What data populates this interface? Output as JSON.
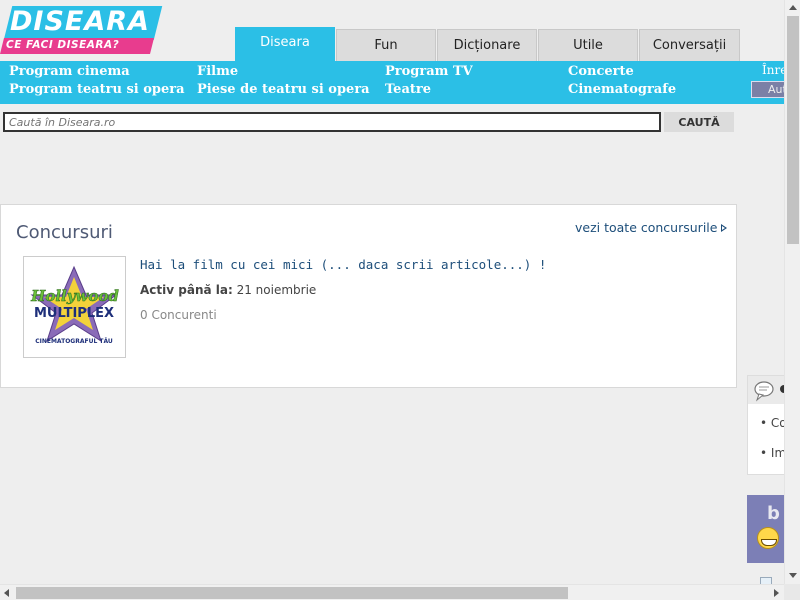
{
  "logo": {
    "title": "DISEARA",
    "tagline": "CE FACI DISEARA?"
  },
  "tabs": [
    {
      "label": "Diseara",
      "active": true
    },
    {
      "label": "Fun",
      "active": false
    },
    {
      "label": "Dicționare",
      "active": false
    },
    {
      "label": "Utile",
      "active": false
    },
    {
      "label": "Conversații",
      "active": false
    }
  ],
  "subnav": {
    "col1": [
      "Program cinema",
      "Program teatru si opera"
    ],
    "col2": [
      "Filme",
      "Piese de teatru si opera"
    ],
    "col3": [
      "Program TV",
      "Teatre"
    ],
    "col4": [
      "Concerte",
      "Cinematografe"
    ],
    "login_link": "Înreg",
    "login_button": "Aut"
  },
  "search": {
    "placeholder": "Caută în Diseara.ro",
    "button_label": "CAUTĂ"
  },
  "contests": {
    "title": "Concursuri",
    "see_all": "vezi toate concursurile",
    "item": {
      "title": "Hai la film cu cei mici (... daca scrii articole...) !",
      "active_label": "Activ până la:",
      "active_value": "21 noiembrie",
      "participants": "0 Concurenti",
      "thumb_logo": "Hollywood",
      "thumb_sub": "MULTIPLEX",
      "thumb_caption": "CINEMATOGRAFUL TĂU"
    }
  },
  "comments": {
    "items": [
      "Co",
      "Im"
    ]
  },
  "promo": {
    "letter": "b"
  },
  "colors": {
    "accent": "#2bbfe6",
    "brand_pink": "#e83c8e",
    "link": "#1d4e7a"
  }
}
